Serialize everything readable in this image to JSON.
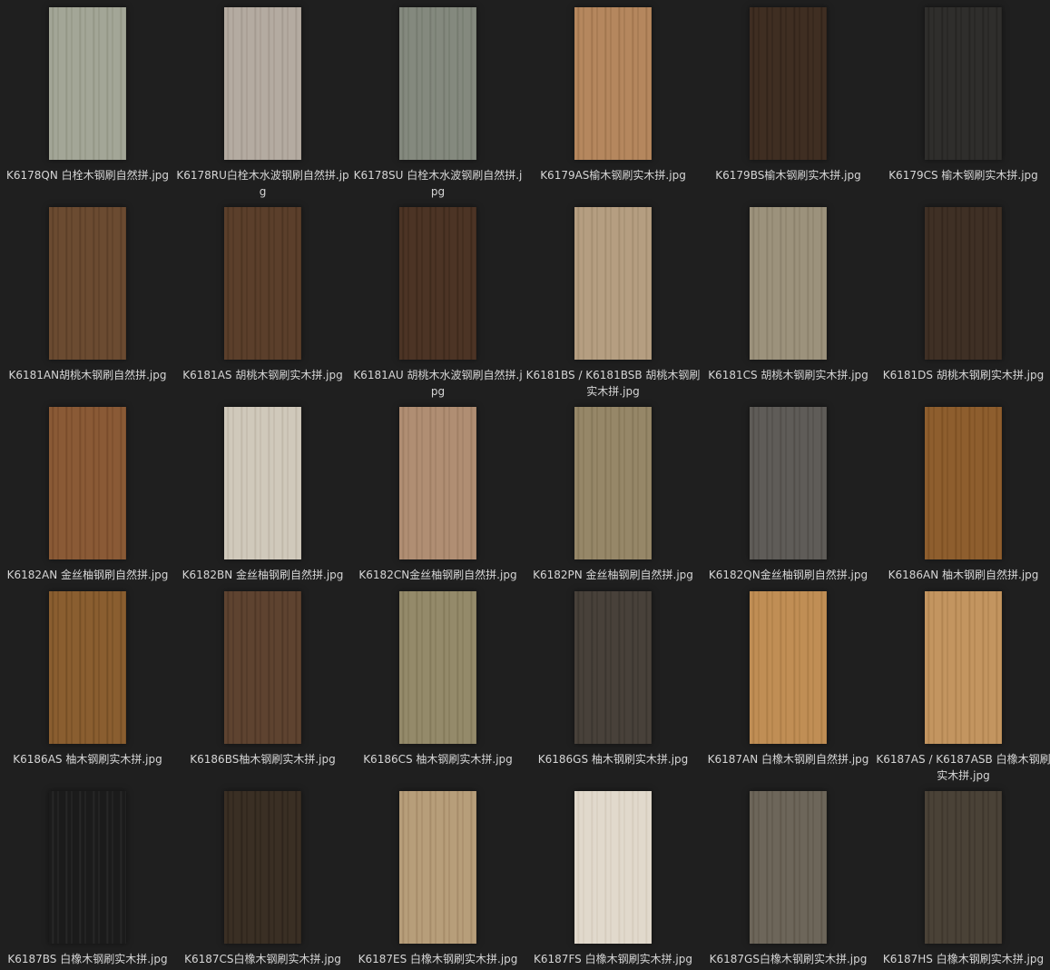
{
  "files": [
    {
      "name": "K6178QN 白栓木钢刷自然拼.jpg",
      "color": "#a3a697",
      "grain": "#8f9282"
    },
    {
      "name": "K6178RU白栓木水波钢刷自然拼.jpg",
      "color": "#b4aba1",
      "grain": "#9f968c"
    },
    {
      "name": "K6178SU 白栓木水波钢刷自然拼.jpg",
      "color": "#84897e",
      "grain": "#71766b"
    },
    {
      "name": "K6179AS榆木钢刷实木拼.jpg",
      "color": "#b5875e",
      "grain": "#9c704a"
    },
    {
      "name": "K6179BS榆木钢刷实木拼.jpg",
      "color": "#3f2e22",
      "grain": "#2f2118"
    },
    {
      "name": "K6179CS 榆木钢刷实木拼.jpg",
      "color": "#2f2e2c",
      "grain": "#232220"
    },
    {
      "name": "K6181AN胡桃木钢刷自然拼.jpg",
      "color": "#6b4b31",
      "grain": "#573b25"
    },
    {
      "name": "K6181AS 胡桃木钢刷实木拼.jpg",
      "color": "#5b3f2b",
      "grain": "#48301f"
    },
    {
      "name": "K6181AU 胡桃木水波钢刷自然拼.jpg",
      "color": "#4c3425",
      "grain": "#3a2619"
    },
    {
      "name": "K6181BS / K6181BSB 胡桃木钢刷实木拼.jpg",
      "color": "#b59e81",
      "grain": "#a08a6d"
    },
    {
      "name": "K6181CS 胡桃木钢刷实木拼.jpg",
      "color": "#9c927c",
      "grain": "#877d68"
    },
    {
      "name": "K6181DS 胡桃木钢刷实木拼.jpg",
      "color": "#3f3025",
      "grain": "#30231a"
    },
    {
      "name": "K6182AN 金丝柚钢刷自然拼.jpg",
      "color": "#8a5a36",
      "grain": "#744828"
    },
    {
      "name": "K6182BN 金丝柚钢刷自然拼.jpg",
      "color": "#d0c9bb",
      "grain": "#bcb4a5"
    },
    {
      "name": "K6182CN金丝柚钢刷自然拼.jpg",
      "color": "#b08e73",
      "grain": "#9a7a60"
    },
    {
      "name": "K6182PN 金丝柚钢刷自然拼.jpg",
      "color": "#968768",
      "grain": "#817355"
    },
    {
      "name": "K6182QN金丝柚钢刷自然拼.jpg",
      "color": "#5f5c58",
      "grain": "#4d4a46"
    },
    {
      "name": "K6186AN 柚木钢刷自然拼.jpg",
      "color": "#8e5e2e",
      "grain": "#784c20"
    },
    {
      "name": "K6186AS 柚木钢刷实木拼.jpg",
      "color": "#8a5e30",
      "grain": "#704a22"
    },
    {
      "name": "K6186BS柚木钢刷实木拼.jpg",
      "color": "#5e4330",
      "grain": "#4a3323"
    },
    {
      "name": "K6186CS 柚木钢刷实木拼.jpg",
      "color": "#948a6a",
      "grain": "#7f7556"
    },
    {
      "name": "K6186GS 柚木钢刷实木拼.jpg",
      "color": "#48413a",
      "grain": "#38322c"
    },
    {
      "name": "K6187AN 白橡木钢刷自然拼.jpg",
      "color": "#c08e55",
      "grain": "#a87943"
    },
    {
      "name": "K6187AS / K6187ASB 白橡木钢刷实木拼.jpg",
      "color": "#c39560",
      "grain": "#ab7f4c"
    },
    {
      "name": "K6187BS 白橡木钢刷实木拼.jpg",
      "color": "#1b1b1b",
      "grain": "#2b2b2b"
    },
    {
      "name": "K6187CS白橡木钢刷实木拼.jpg",
      "color": "#3a2f24",
      "grain": "#2a2119"
    },
    {
      "name": "K6187ES 白橡木钢刷实木拼.jpg",
      "color": "#b79e7a",
      "grain": "#a08764"
    },
    {
      "name": "K6187FS 白橡木钢刷实木拼.jpg",
      "color": "#e1d9cc",
      "grain": "#d2c9ba"
    },
    {
      "name": "K6187GS白橡木钢刷实木拼.jpg",
      "color": "#6d665a",
      "grain": "#5b5448"
    },
    {
      "name": "K6187HS 白橡木钢刷实木拼.jpg",
      "color": "#4a4237",
      "grain": "#3a332a"
    }
  ]
}
